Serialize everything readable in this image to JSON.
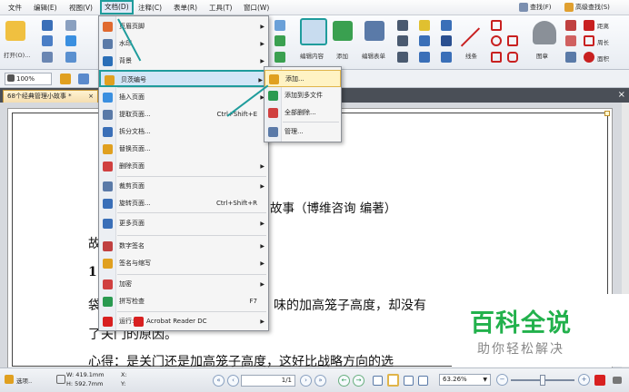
{
  "menubar": {
    "items": [
      {
        "label": "文件"
      },
      {
        "label": "编辑(E)"
      },
      {
        "label": "视图(V)"
      },
      {
        "label": "文档(D)"
      },
      {
        "label": "注释(C)"
      },
      {
        "label": "表单(R)"
      },
      {
        "label": "工具(T)"
      },
      {
        "label": "窗口(W)"
      }
    ],
    "search_label": "查找(F)",
    "adv_search_label": "高级查找(S)"
  },
  "ribbon": {
    "open_label": "打开(O)...",
    "edit_content_label": "编辑内容",
    "add_label": "添加",
    "edit_form_label": "编辑表单",
    "line_label": "线条",
    "stamp_label": "图章",
    "distance_label": "距离",
    "perimeter_label": "周长",
    "area_label": "面积"
  },
  "toolbar2": {
    "zoom": "100%"
  },
  "tab": {
    "label": "68个经典管理小故事 *"
  },
  "document": {
    "lines": [
      "故事（博维咨询   编著）",
      "故",
      "1",
      "袋",
      "味的加高笼子高度，却没有",
      "了关门的原因。",
      "心得：是关门还是加高笼子高度，这好比战略方向的选"
    ]
  },
  "watermark": {
    "title": "百科全说",
    "subtitle": "助你轻松解决"
  },
  "statusbar": {
    "select_label": "选项..",
    "width": "W: 419.1mm",
    "height": "H: 592.7mm",
    "x": "X:",
    "y": "Y:",
    "page": "1/1",
    "zoom": "63.26%"
  },
  "document_menu": {
    "items": [
      {
        "label": "页眉页脚",
        "short": "",
        "arrow": true
      },
      {
        "label": "水印",
        "short": "",
        "arrow": true
      },
      {
        "label": "背景",
        "short": "",
        "arrow": true
      },
      {
        "label": "贝茨编号",
        "short": "",
        "arrow": true
      },
      {
        "label": "插入页面",
        "short": "",
        "arrow": true
      },
      {
        "label": "提取页面...",
        "short": "Ctrl+Shift+E",
        "arrow": false
      },
      {
        "label": "拆分文档...",
        "short": "",
        "arrow": false
      },
      {
        "label": "替换页面...",
        "short": "",
        "arrow": false
      },
      {
        "label": "删除页面",
        "short": "",
        "arrow": true
      },
      {
        "label": "裁剪页面",
        "short": "",
        "arrow": true
      },
      {
        "label": "旋转页面...",
        "short": "Ctrl+Shift+R",
        "arrow": false
      },
      {
        "label": "更多页面",
        "short": "",
        "arrow": true
      },
      {
        "label": "数字签名",
        "short": "",
        "arrow": true
      },
      {
        "label": "签名与缩写",
        "short": "",
        "arrow": true
      },
      {
        "label": "加密",
        "short": "",
        "arrow": true
      },
      {
        "label": "拼写检查",
        "short": "F7",
        "arrow": false
      },
      {
        "label": "运行:",
        "short": "",
        "arrow": true,
        "extra": "Acrobat Reader DC"
      }
    ]
  },
  "bates_menu": {
    "items": [
      {
        "label": "添加..."
      },
      {
        "label": "添加到多文件"
      },
      {
        "label": "全部删除..."
      },
      {
        "label": "管理..."
      }
    ]
  }
}
